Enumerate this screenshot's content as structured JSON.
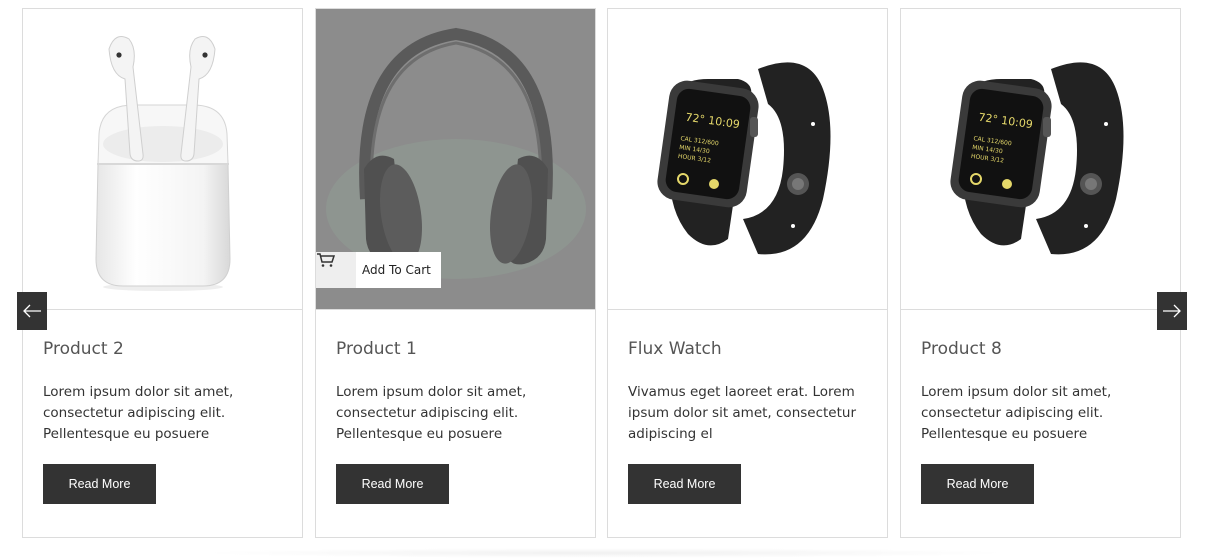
{
  "carousel": {
    "prev_icon": "arrow-left-icon",
    "next_icon": "arrow-right-icon",
    "read_more_label": "Read More",
    "add_to_cart_label": "Add To Cart",
    "cart_icon": "cart-icon",
    "products": [
      {
        "title": "Product 2",
        "description": "Lorem ipsum dolor sit amet, consectetur adipiscing elit. Pellentesque eu posuere",
        "image": "airpods"
      },
      {
        "title": "Product 1",
        "description": "Lorem ipsum dolor sit amet, consectetur adipiscing elit. Pellentesque eu posuere",
        "image": "headphones"
      },
      {
        "title": "Flux Watch",
        "description": "Vivamus eget laoreet erat. Lorem ipsum dolor sit amet, consectetur adipiscing el",
        "image": "watch"
      },
      {
        "title": "Product 8",
        "description": "Lorem ipsum dolor sit amet, consectetur adipiscing elit. Pellentesque eu posuere",
        "image": "watch"
      }
    ]
  },
  "colors": {
    "button_bg": "#333333",
    "border": "#dcdcdc",
    "overlay": "#8c8c8c"
  }
}
